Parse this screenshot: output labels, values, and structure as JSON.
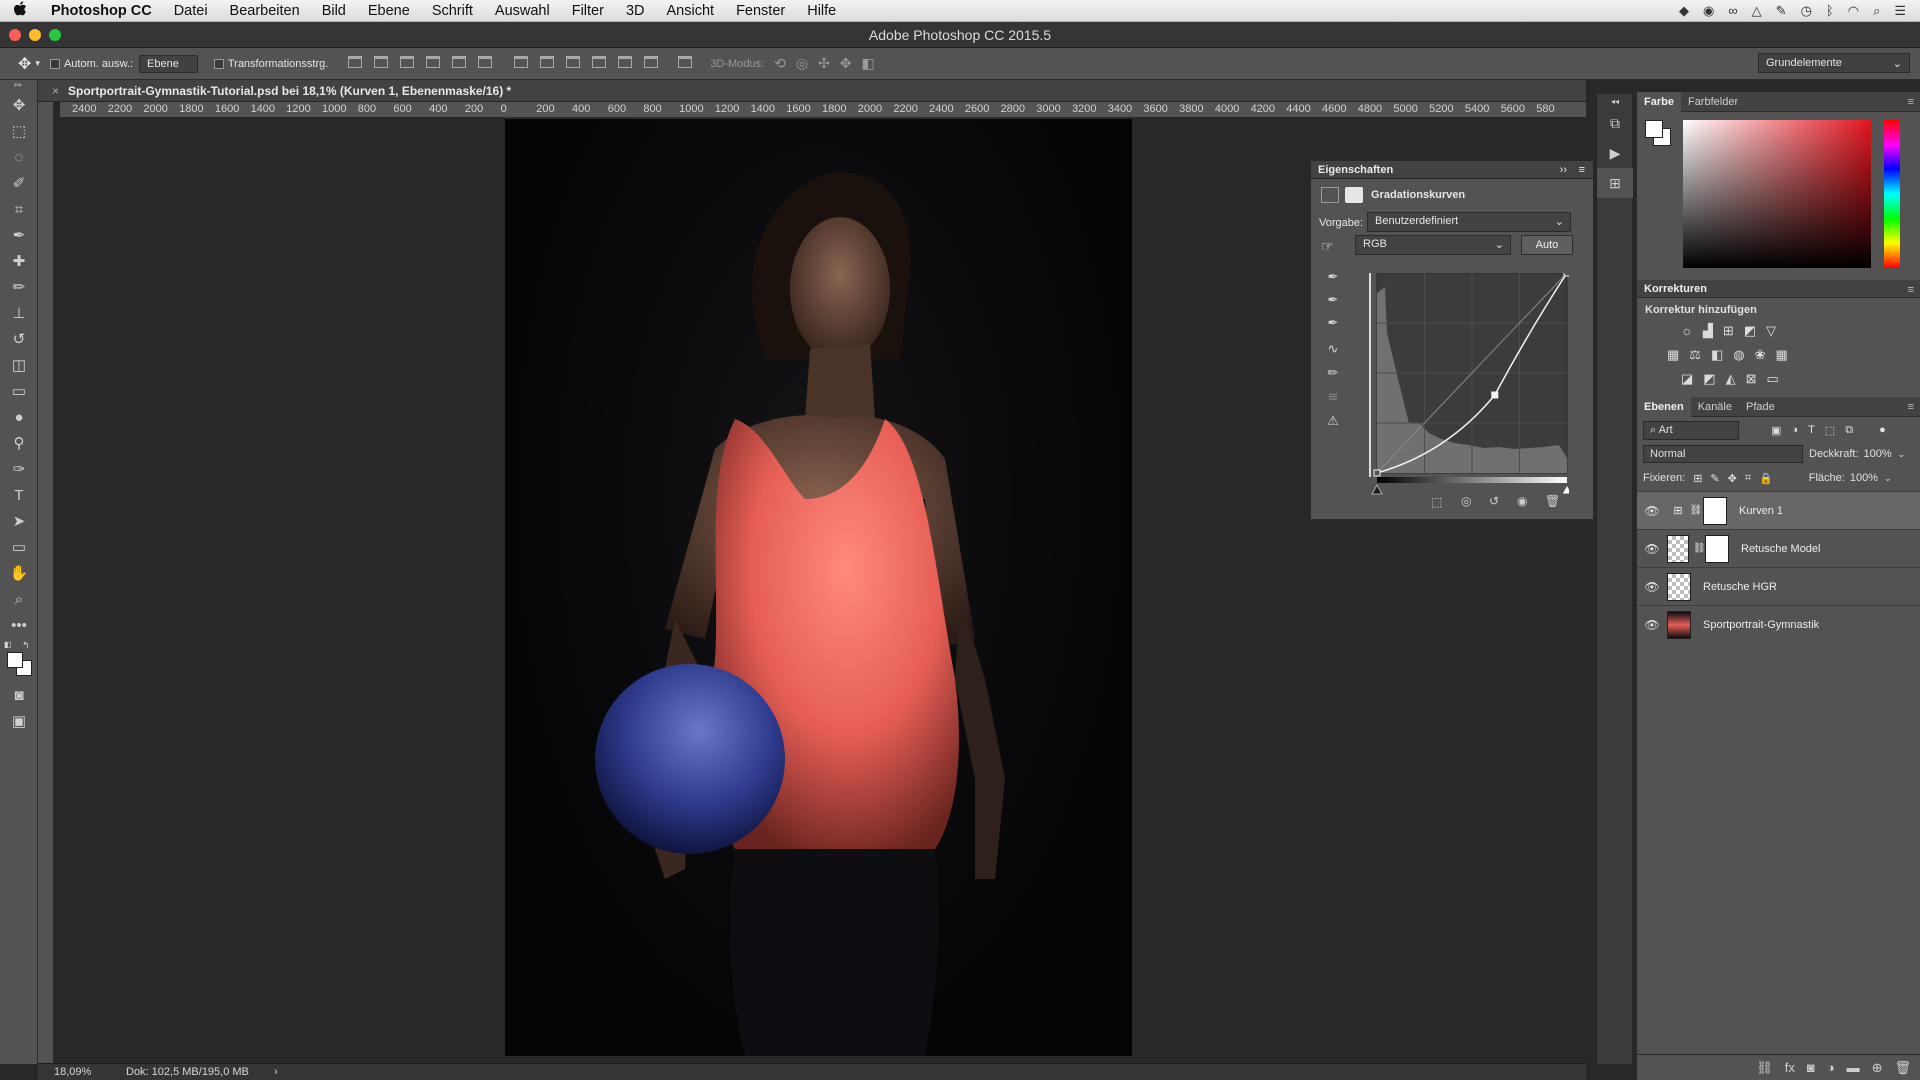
{
  "menubar": {
    "apple": "",
    "app": "Photoshop CC",
    "items": [
      "Datei",
      "Bearbeiten",
      "Bild",
      "Ebene",
      "Schrift",
      "Auswahl",
      "Filter",
      "3D",
      "Ansicht",
      "Fenster",
      "Hilfe"
    ]
  },
  "window": {
    "title": "Adobe Photoshop CC 2015.5"
  },
  "options_bar": {
    "auto_select_label": "Autom. ausw.:",
    "auto_select_value": "Ebene",
    "transform_label": "Transformationsstrg.",
    "mode_3d_label": "3D-Modus:",
    "workspace": "Grundelemente"
  },
  "document": {
    "tab_title": "Sportportrait-Gymnastik-Tutorial.psd bei 18,1% (Kurven 1, Ebenenmaske/16) *",
    "ruler_ticks": [
      "2400",
      "2200",
      "2000",
      "1800",
      "1600",
      "1400",
      "1200",
      "1000",
      "800",
      "600",
      "400",
      "200",
      "0",
      "200",
      "400",
      "600",
      "800",
      "1000",
      "1200",
      "1400",
      "1600",
      "1800",
      "2000",
      "2200",
      "2400",
      "2600",
      "2800",
      "3000",
      "3200",
      "3400",
      "3600",
      "3800",
      "4000",
      "4200",
      "4400",
      "4600",
      "4800",
      "5000",
      "5200",
      "5400",
      "5600",
      "580"
    ],
    "zoom": "18,09%",
    "doc_info": "Dok: 102,5 MB/195,0 MB"
  },
  "properties": {
    "title": "Eigenschaften",
    "adjustment_name": "Gradationskurven",
    "preset_label": "Vorgabe:",
    "preset_value": "Benutzerdefiniert",
    "channel_value": "RGB",
    "auto_label": "Auto",
    "curve_points": [
      [
        0,
        0
      ],
      [
        0.62,
        0.39
      ],
      [
        1,
        1
      ]
    ]
  },
  "color_panel": {
    "tabs": [
      "Farbe",
      "Farbfelder"
    ],
    "foreground": "#ffffff",
    "background": "#ffffff"
  },
  "adjustments_panel": {
    "title": "Korrekturen",
    "subtitle": "Korrektur hinzufügen"
  },
  "layers_panel": {
    "tabs": [
      "Ebenen",
      "Kanäle",
      "Pfade"
    ],
    "filter_value": "Art",
    "blend_mode": "Normal",
    "opacity_label": "Deckkraft:",
    "opacity_value": "100%",
    "lock_label": "Fixieren:",
    "fill_label": "Fläche:",
    "fill_value": "100%",
    "layers": [
      {
        "name": "Kurven 1",
        "selected": true
      },
      {
        "name": "Retusche Model",
        "selected": false
      },
      {
        "name": "Retusche HGR",
        "selected": false
      },
      {
        "name": "Sportportrait-Gymnastik",
        "selected": false
      }
    ]
  }
}
